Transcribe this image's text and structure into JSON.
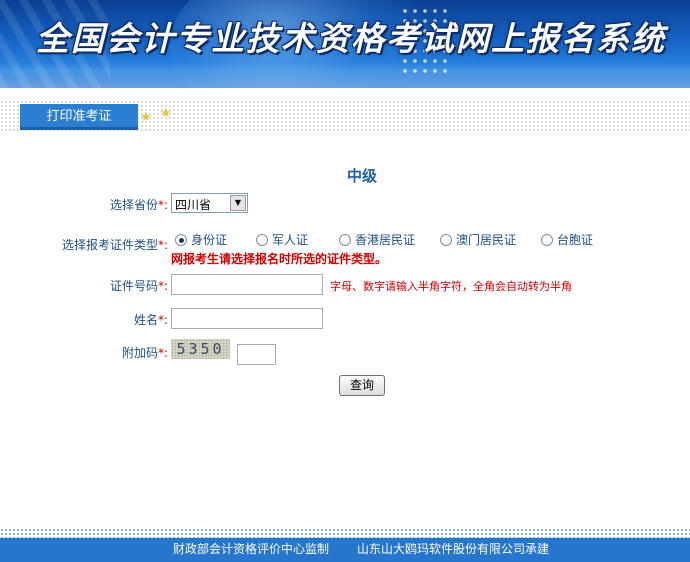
{
  "banner": {
    "title": "全国会计专业技术资格考试网上报名系统"
  },
  "tab": {
    "label": "打印准考证"
  },
  "level": "中级",
  "form": {
    "province": {
      "label": "选择省份",
      "required_mark": "*:",
      "value": "四川省"
    },
    "id_type": {
      "label": "选择报考证件类型",
      "required_mark": "*:",
      "options": [
        "身份证",
        "军人证",
        "香港居民证",
        "澳门居民证",
        "台胞证"
      ],
      "selected": "身份证",
      "warning": "网报考生请选择报名时所选的证件类型。"
    },
    "id_number": {
      "label": "证件号码",
      "required_mark": "*:",
      "value": "",
      "hint": "字母、数字请输入半角字符，全角会自动转为半角"
    },
    "name": {
      "label": "姓名",
      "required_mark": "*:",
      "value": ""
    },
    "captcha": {
      "label": "附加码",
      "required_mark": "*:",
      "image_text": "5350",
      "value": ""
    },
    "submit_label": "查询"
  },
  "footer": {
    "left": "财政部会计资格评价中心监制",
    "right": "山东山大鸥玛软件股份有限公司承建"
  },
  "colors": {
    "banner": "#1664c6",
    "tab": "#2b7fd3",
    "footer": "#2676cd",
    "label": "#1f4f86",
    "warning": "#d00000"
  }
}
